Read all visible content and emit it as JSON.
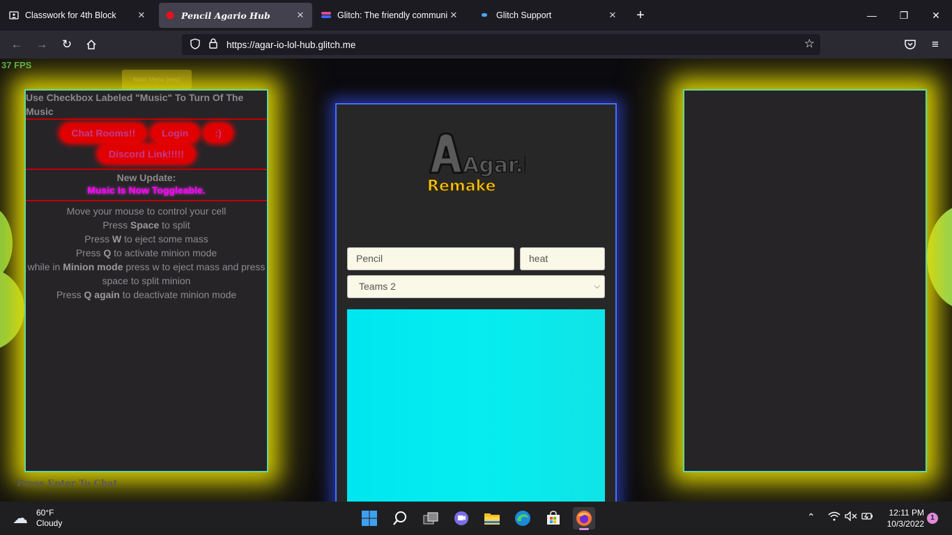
{
  "tabs": [
    {
      "title": "Classwork for 4th Block",
      "icon": "classroom-icon",
      "active": false
    },
    {
      "title": "Pencil Agario Hub",
      "icon": "red-dot-icon",
      "active": true
    },
    {
      "title": "Glitch: The friendly community",
      "icon": "glitch-icon",
      "active": false
    },
    {
      "title": "Glitch Support",
      "icon": "glitch-support-icon",
      "active": false
    }
  ],
  "address": {
    "url": "https://agar-io-lol-hub.glitch.me"
  },
  "game": {
    "fps": "37 FPS",
    "main_menu_label": "Main Menu (esc)",
    "notice": "Use Checkbox Labeled \"Music\" To Turn Of The Music",
    "buttons": {
      "chat_rooms": "Chat Rooms!!",
      "login": "Login",
      "smiley": ":)",
      "discord": "Discord Link!!!!!"
    },
    "update_title": "New Update:",
    "update_text": "Music Is Now Toggleable.",
    "instructions": {
      "l1": "Move your mouse to control your cell",
      "l2a": "Press ",
      "l2b": "Space",
      "l2c": " to split",
      "l3a": "Press ",
      "l3b": "W",
      "l3c": " to eject some mass",
      "l4a": "Press ",
      "l4b": "Q",
      "l4c": " to activate minion mode",
      "l5a": "while in ",
      "l5b": "Minion mode",
      "l5c": " press w to eject mass and press space to split minion",
      "l6a": "Press ",
      "l6b": "Q again",
      "l6c": " to deactivate minion mode"
    },
    "logo": {
      "line1": "Agar.io",
      "line2": "Remake"
    },
    "nick_value": "Pencil",
    "server_value": "heat",
    "mode_selected": "Teams 2",
    "chat_hint": "Press Enter To Chat"
  },
  "taskbar": {
    "temp": "60°F",
    "condition": "Cloudy",
    "time": "12:11 PM",
    "date": "10/3/2022",
    "notifications": "1"
  },
  "colors": {
    "panel_glow": "#e6dc00",
    "center_border": "#4a6cff",
    "preview": "#00e6f0"
  }
}
